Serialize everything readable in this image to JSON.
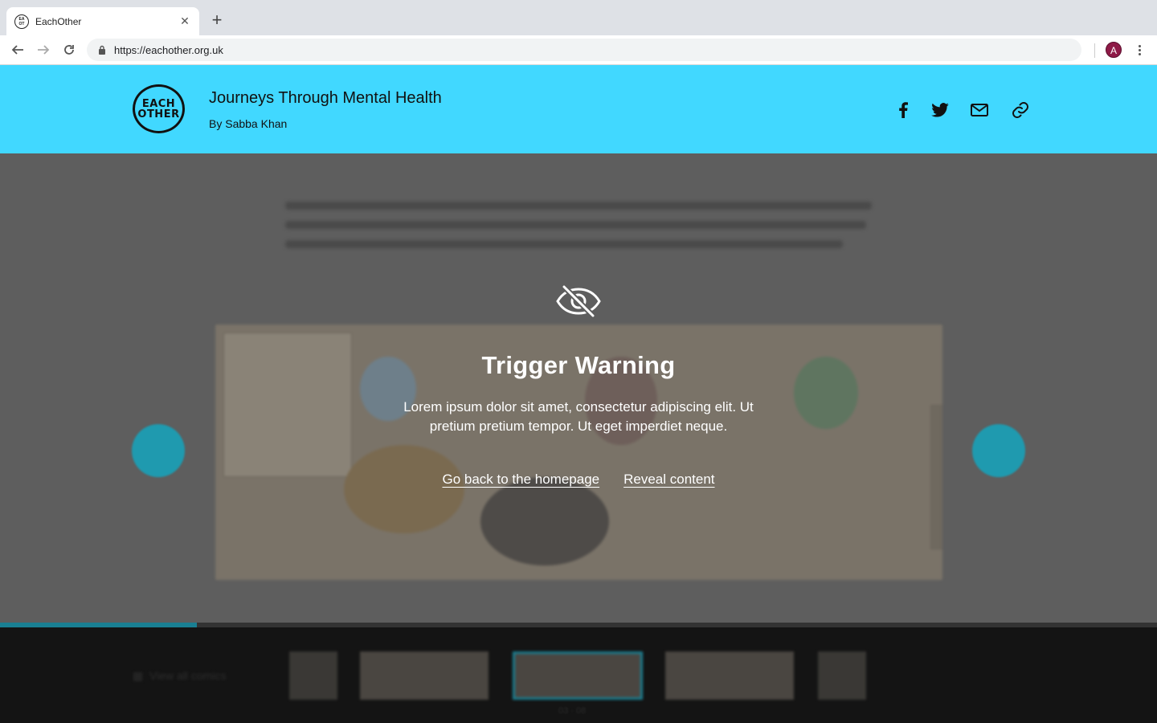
{
  "browser": {
    "tab_title": "EachOther",
    "favicon_text": "EACH OTHER",
    "url": "https://eachother.org.uk",
    "avatar_letter": "A"
  },
  "header": {
    "logo_line1": "EACH",
    "logo_line2": "OTHER",
    "title": "Journeys Through Mental Health",
    "byline": "By Sabba Khan",
    "share_icons": [
      "facebook-icon",
      "twitter-icon",
      "email-icon",
      "link-icon"
    ]
  },
  "warning": {
    "icon": "eye-slash-icon",
    "title": "Trigger Warning",
    "body": "Lorem ipsum dolor sit amet, consectetur adipiscing elit. Ut pretium pretium tempor. Ut eget imperdiet neque.",
    "back_link": "Go back to the homepage",
    "reveal_link": "Reveal content"
  },
  "colors": {
    "header_bg": "#41d8ff",
    "accent": "#1a7f92",
    "overlay_bg": "#5e5e5e",
    "strip_bg": "#141414"
  },
  "carousel": {
    "progress": 0.17
  }
}
